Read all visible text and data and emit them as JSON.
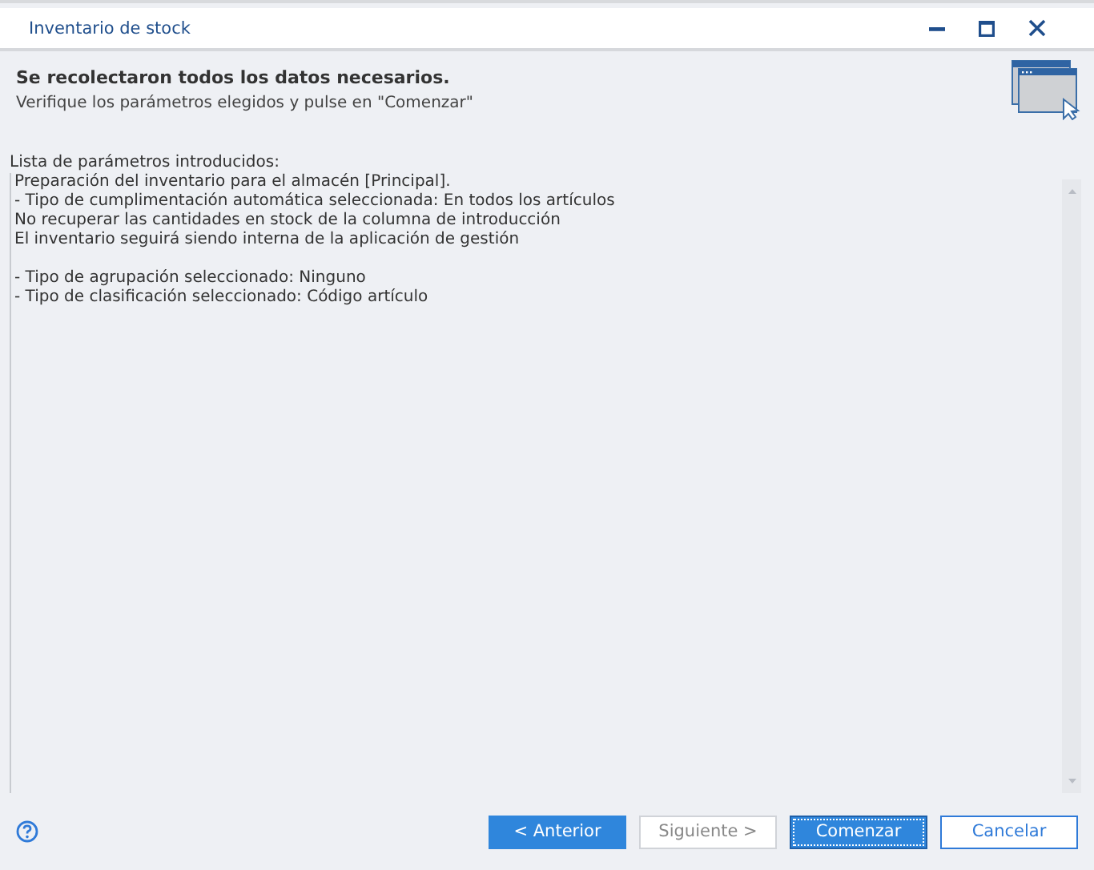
{
  "window": {
    "title": "Inventario de stock"
  },
  "header": {
    "title": "Se recolectaron todos los datos necesarios.",
    "subtitle": "Verifique los parámetros elegidos y pulse en \"Comenzar\""
  },
  "summary": {
    "label": "Lista de parámetros introducidos:",
    "paragraphs": [
      [
        "Preparación del inventario para el almacén [Principal].",
        "- Tipo de cumplimentación automática seleccionada: En todos los artículos",
        "No recuperar las cantidades en stock de la columna de introducción",
        "El inventario seguirá siendo interna de la aplicación de gestión"
      ],
      [
        "- Tipo de agrupación seleccionado: Ninguno",
        "- Tipo de clasificación seleccionado: Código artículo"
      ]
    ]
  },
  "buttons": [
    {
      "label": "< Anterior",
      "kind": "primary",
      "disabled": false
    },
    {
      "label": "Siguiente >",
      "kind": "secondary",
      "disabled": true
    },
    {
      "label": "Comenzar",
      "kind": "primary",
      "disabled": false,
      "focused": true
    },
    {
      "label": "Cancelar",
      "kind": "outline",
      "disabled": false
    }
  ]
}
